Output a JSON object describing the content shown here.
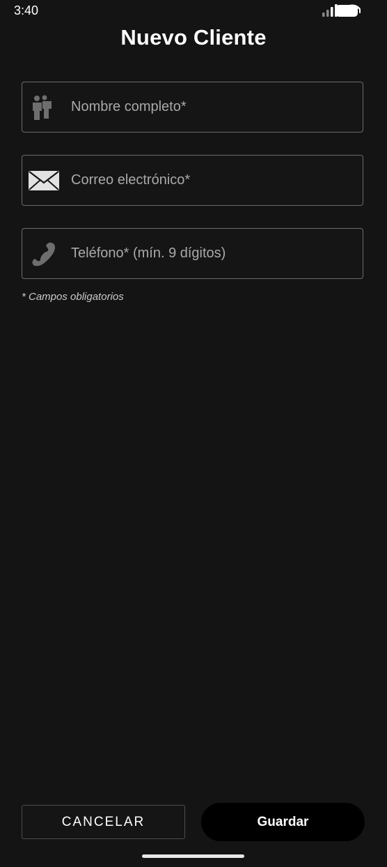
{
  "status_bar": {
    "time": "3:40",
    "icons": [
      "signal-icon",
      "wifi-icon",
      "battery-icon"
    ]
  },
  "header": {
    "title": "Nuevo Cliente"
  },
  "form": {
    "fields": [
      {
        "icon": "user-icon",
        "placeholder": "Nombre completo*",
        "value": ""
      },
      {
        "icon": "envelope-icon",
        "placeholder": "Correo electrónico*",
        "value": ""
      },
      {
        "icon": "phone-icon",
        "placeholder": "Teléfono* (mín. 9 dígitos)",
        "value": ""
      }
    ],
    "required_note": "* Campos obligatorios"
  },
  "actions": {
    "cancel_label": "CANCELAR",
    "save_label": "Guardar"
  },
  "colors": {
    "background": "#141414",
    "border": "#6c6c6c",
    "placeholder": "#a9a9a9",
    "save_button": "#000000"
  }
}
